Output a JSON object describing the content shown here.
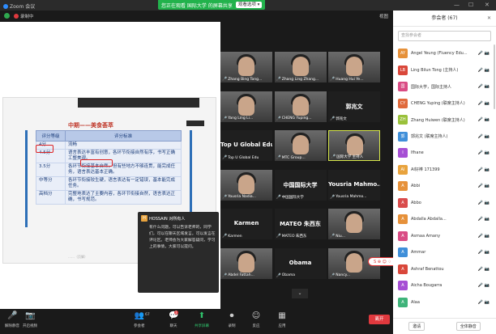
{
  "window": {
    "app_name": "Zoom 会议",
    "minimize": "—",
    "maximize": "☐",
    "close": "✕"
  },
  "share_banner": {
    "text": "您正在观看 国际大学 的屏幕共享",
    "stop_label": "观看选项 ▾"
  },
  "meeting": {
    "recording_label": "录制中",
    "view_label": "视图"
  },
  "slide": {
    "title": "中期——美食荟萃",
    "headers": [
      "评分等级",
      "评分标准"
    ],
    "rows": [
      {
        "level": "4分",
        "criteria": "流畅"
      },
      {
        "level": "4.5分",
        "criteria": "语言表达丰富有创意，各环节衔接自然有序，书写正确工整美观。"
      },
      {
        "level": "3.5分",
        "criteria": "各环节衔接基本自然，但有些地方不够连贯，能完成任务，语言表达基本正确。"
      },
      {
        "level": "中等分",
        "criteria": "各环节衔接较生硬，语言表达有一定错误，基本能完成任务。"
      },
      {
        "level": "高档分",
        "criteria": "完整地表达了主要内容，各环节衔接自然，语言表达正确，书写规范。"
      }
    ],
    "footer": "……（页脚）"
  },
  "tiles": [
    {
      "name": "Zhang Bing Tong...",
      "kind": "photo"
    },
    {
      "name": "Zhang Ling Zhang...",
      "kind": "photo"
    },
    {
      "name": "Huang Hui Ye...",
      "kind": "photo"
    },
    {
      "name": "Yang Ling Li...",
      "kind": "photo"
    },
    {
      "name": "CHENG Yuping...",
      "kind": "photo"
    },
    {
      "name": "郭兆文",
      "kind": "name"
    },
    {
      "name": "Top U Global Edu",
      "kind": "name"
    },
    {
      "name": "MTC Group...",
      "kind": "photo"
    },
    {
      "name": "国际大学 主持人",
      "kind": "photo",
      "active": true
    },
    {
      "name": "Yousria Nadia...",
      "kind": "photo"
    },
    {
      "name": "中国国际大学",
      "kind": "name"
    },
    {
      "name": "Yousria Mahmo...",
      "kind": "name"
    },
    {
      "name": "Karmen",
      "kind": "name"
    },
    {
      "name": "MATEO 朱西东",
      "kind": "name"
    },
    {
      "name": "Niu...",
      "kind": "photo"
    },
    {
      "name": "Abdel Fattah...",
      "kind": "photo"
    },
    {
      "name": "Obama",
      "kind": "name"
    },
    {
      "name": "Nancy...",
      "kind": "photo"
    }
  ],
  "chat": {
    "sender": "HOSSAIN 对所有人",
    "avatar": "H",
    "message": "有什么问题，可以告诉老师的，同学们，可以在聊天区域发言。可以发言在评论区。老师会为大家解答疑问，学习上的事情，大家可以提问。"
  },
  "scroll_arrow": "⌄",
  "float_widget": "S ⊕ ☺ ♢ ⚇",
  "toolbar": [
    {
      "label": "解除静音",
      "icon": "🎤"
    },
    {
      "label": "开启视频",
      "icon": "📷"
    },
    {
      "label": "参会者",
      "icon": "👥",
      "count": "67"
    },
    {
      "label": "聊天",
      "icon": "💬",
      "badge": "3"
    },
    {
      "label": "共享屏幕",
      "icon": "⬆",
      "green": true
    },
    {
      "label": "录制",
      "icon": "⏺"
    },
    {
      "label": "反应",
      "icon": "☺"
    },
    {
      "label": "应用",
      "icon": "▦"
    }
  ],
  "leave_label": "离开",
  "panel": {
    "title": "参会者 (67)",
    "search_placeholder": "查找参会者",
    "participants": [
      {
        "initials": "AY",
        "name": "Angel Yeung (Fluency Edu...",
        "color": "#e6913a"
      },
      {
        "initials": "LB",
        "name": "Ling Bilun Tong (主持人)",
        "color": "#d9473a"
      },
      {
        "initials": "国",
        "name": "国际大学，国际主持人",
        "color": "#d94c84"
      },
      {
        "initials": "CY",
        "name": "CHENG Yuping (联席主持人)",
        "color": "#e06a3c"
      },
      {
        "initials": "ZH",
        "name": "Zhang Huiwen (联席主持人)",
        "color": "#9ac13b"
      },
      {
        "initials": "郭",
        "name": "郭兆文 (联席主持人)",
        "color": "#3f8fd9"
      },
      {
        "initials": "I",
        "name": "Ifhane",
        "color": "#a64fd4"
      },
      {
        "initials": "AI",
        "name": "AI好棒 171399",
        "color": "#e8a33d"
      },
      {
        "initials": "A",
        "name": "Abbi",
        "color": "#e6913a"
      },
      {
        "initials": "A",
        "name": "Abbo",
        "color": "#d94c4c"
      },
      {
        "initials": "A",
        "name": "Abdalla Abdalla...",
        "color": "#e6913a"
      },
      {
        "initials": "A",
        "name": "Asmaa Amany",
        "color": "#d94c84"
      },
      {
        "initials": "A",
        "name": "Ammar",
        "color": "#3f8fd9"
      },
      {
        "initials": "A",
        "name": "Ashraf Benattou",
        "color": "#d9473a"
      },
      {
        "initials": "A",
        "name": "Aicha Bougarra",
        "color": "#a64fd4"
      },
      {
        "initials": "A",
        "name": "Alaa",
        "color": "#3fb37a"
      }
    ],
    "invite_label": "邀请",
    "mute_all_label": "全体静音"
  }
}
